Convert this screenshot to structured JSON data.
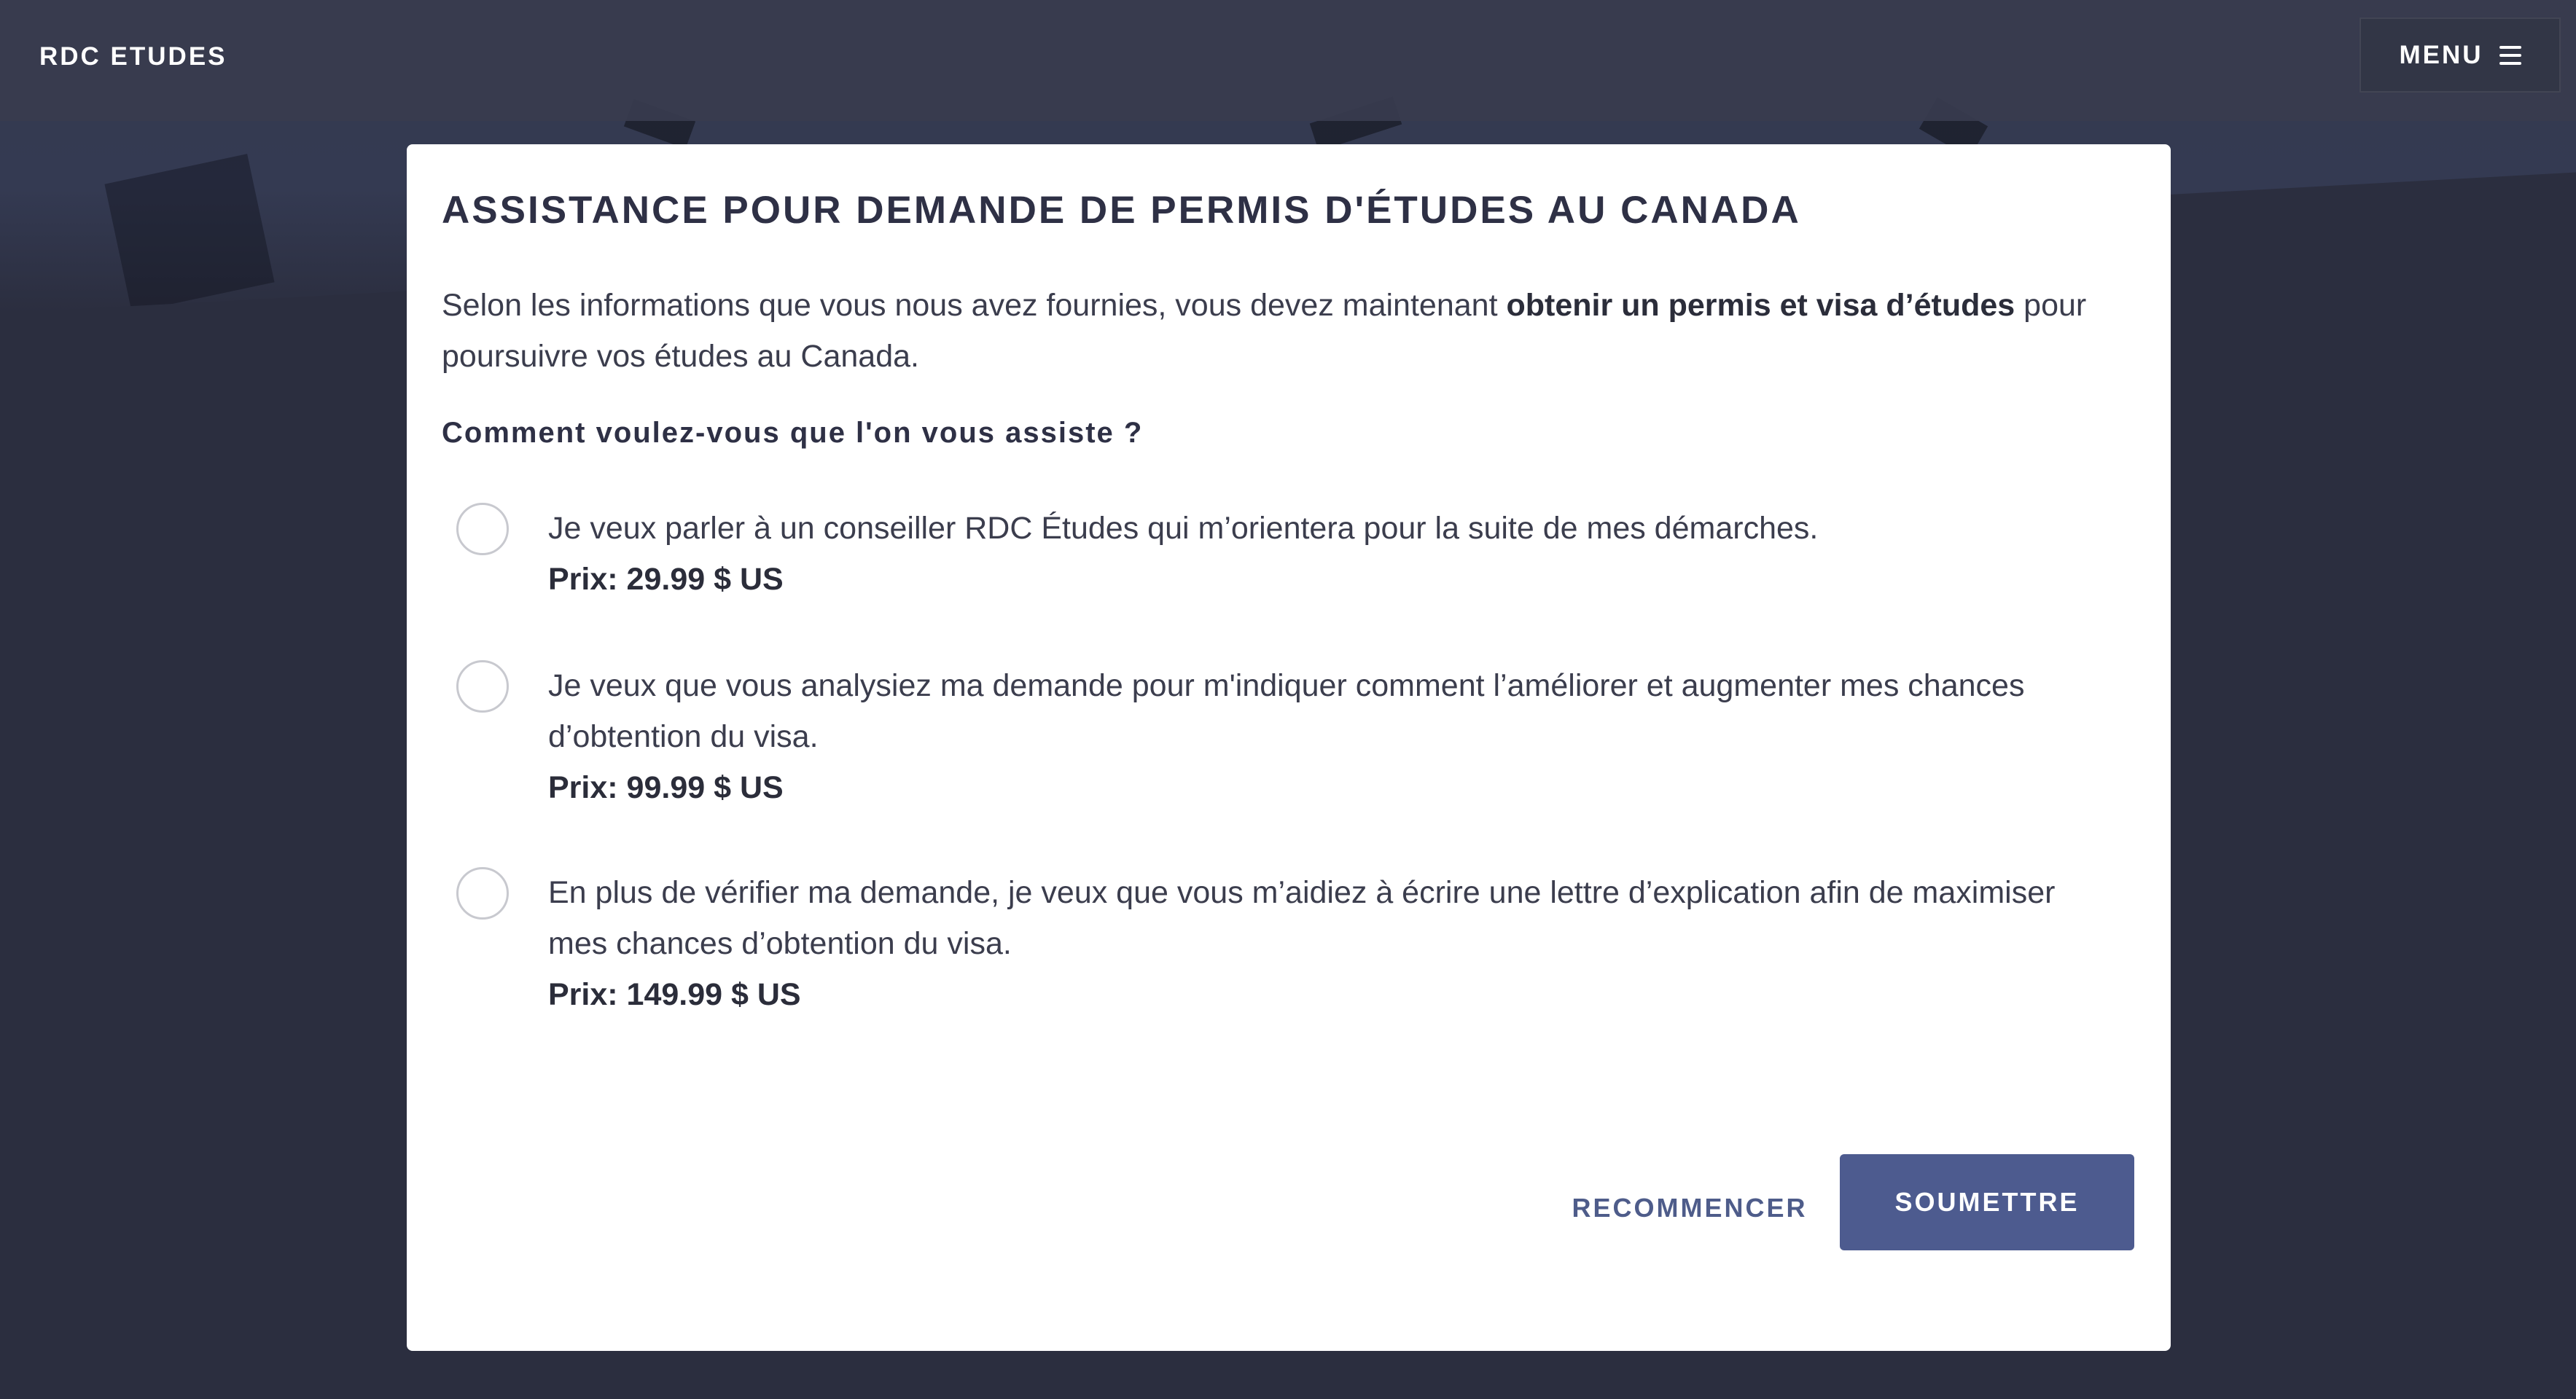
{
  "header": {
    "brand": "RDC ETUDES",
    "menu_label": "MENU",
    "menu_icon": "hamburger-icon"
  },
  "modal": {
    "title": "ASSISTANCE POUR DEMANDE DE PERMIS D'ÉTUDES AU CANADA",
    "intro": {
      "before": "Selon les informations que vous nous avez fournies, vous devez maintenant ",
      "bold": "obtenir un permis et visa d’études",
      "after": " pour poursuivre vos études au Canada."
    },
    "question": "Comment voulez-vous que l'on vous assiste ?",
    "options": [
      {
        "text": "Je veux parler à un conseiller RDC Études qui m’orientera pour la suite de mes démarches.",
        "price": "Prix: 29.99 $ US",
        "selected": false
      },
      {
        "text": "Je veux que vous analysiez ma demande pour m'indiquer comment l’améliorer et augmenter mes chances d’obtention du visa.",
        "price": "Prix: 99.99 $ US",
        "selected": false
      },
      {
        "text": "En plus de vérifier ma demande, je veux que vous m’aidiez à écrire une lettre d’explication afin de maximiser mes chances d’obtention du visa.",
        "price": "Prix: 149.99 $ US",
        "selected": false
      }
    ],
    "restart_label": "RECOMMENCER",
    "submit_label": "SOUMETTRE"
  },
  "colors": {
    "background": "#2b2e3f",
    "header": "#383c4e",
    "accent": "#4d5b8f",
    "text": "#3b3d4d"
  }
}
